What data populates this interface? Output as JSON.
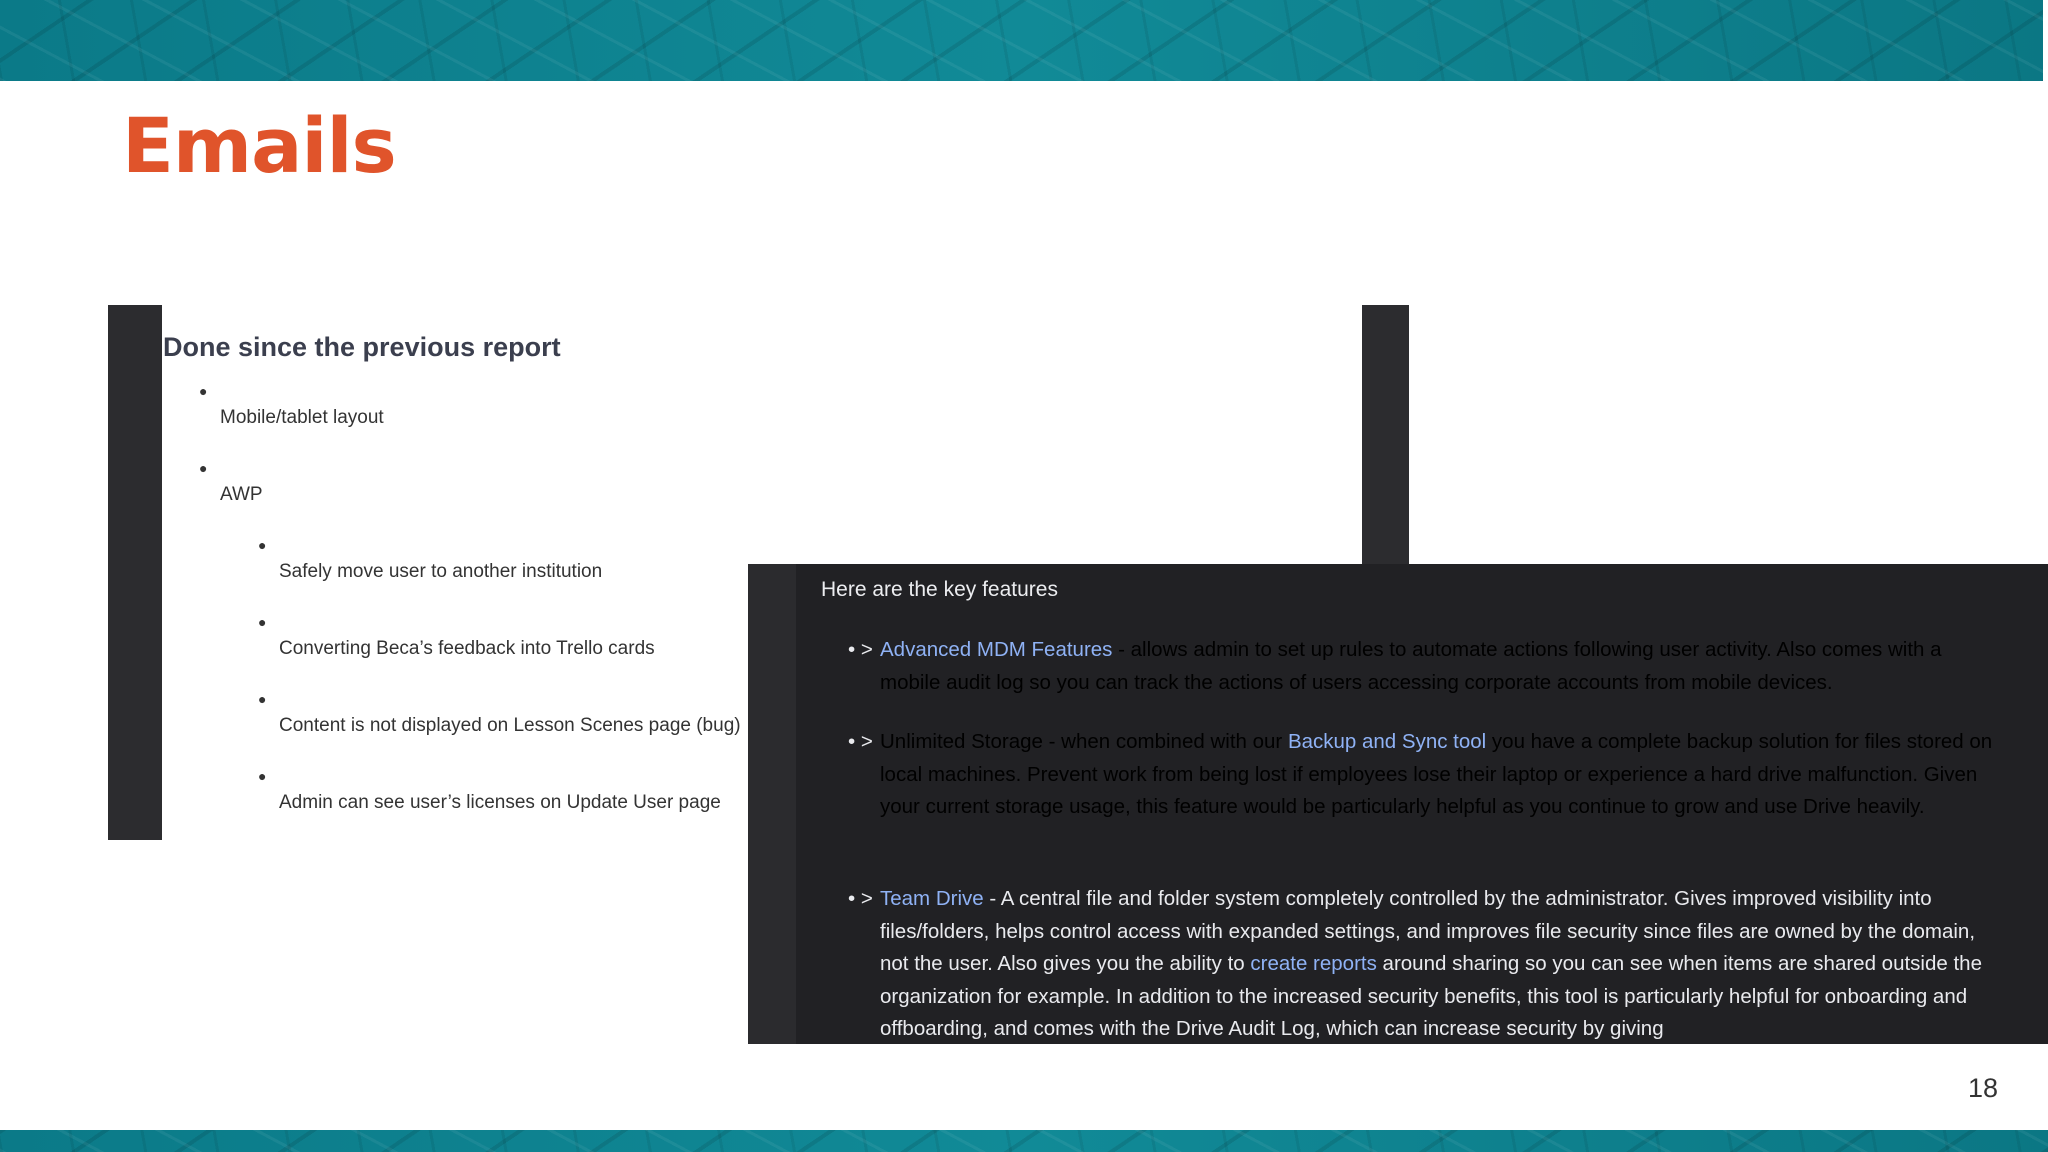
{
  "slide": {
    "title": "Emails",
    "page_number": "18",
    "accent_color": "#e0542b",
    "band_color": "#0d8290"
  },
  "report": {
    "heading": "Done since the previous report",
    "items": [
      {
        "text": "Mobile/tablet layout",
        "level": 1
      },
      {
        "text": "AWP",
        "level": 1
      },
      {
        "text": "Safely move user to another institution",
        "level": 2
      },
      {
        "text": "Converting Beca’s feedback into Trello cards",
        "level": 2
      },
      {
        "text": "Content is not displayed on Lesson Scenes page (bug)",
        "level": 2
      },
      {
        "text": "Admin can see user’s licenses on Update User page",
        "level": 2
      }
    ]
  },
  "features": {
    "intro": "Here are the key features",
    "marker": "• >",
    "items": [
      {
        "title": "Advanced MDM Features",
        "desc": " - allows admin to set up rules to automate actions following user activity. Also comes with a mobile audit log so you can track the actions of users accessing corporate accounts from mobile devices."
      },
      {
        "title": "Unlimited Storage",
        "desc_pre": " - when combined with our ",
        "link": "Backup and Sync tool",
        "desc_post": " you have a complete backup solution for files stored on local machines. Prevent work from being lost if employees lose their laptop or experience a hard drive malfunction. Given your current storage usage, this feature would be particularly helpful as you continue to grow and use Drive heavily."
      },
      {
        "title": "Team Drive",
        "desc_pre": " - A central file and folder system completely controlled by the administrator. Gives improved visibility into files/folders, helps control access with expanded settings, and improves file security since files are owned by the domain, not the user. Also gives you the ability to ",
        "link": "create reports",
        "desc_post": " around sharing so you can see when items are shared outside the organization for example. In addition to the increased security benefits, this tool is particularly helpful for onboarding and offboarding, and comes with the Drive Audit Log, which can increase security by giving"
      }
    ]
  }
}
